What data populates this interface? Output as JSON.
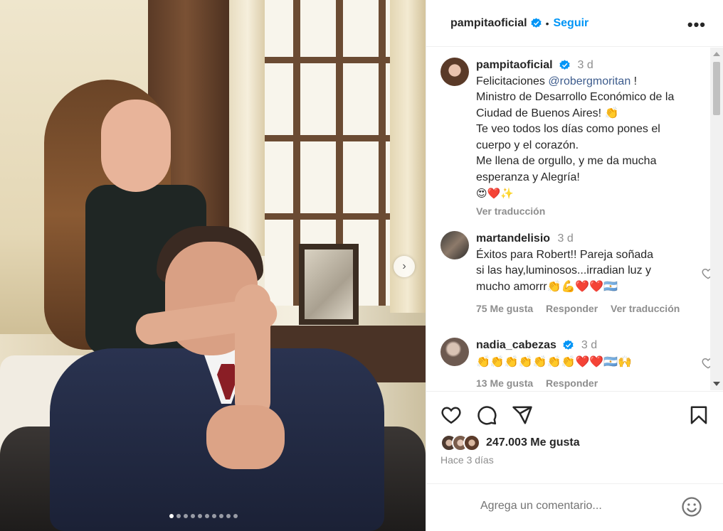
{
  "post": {
    "author": "pampitaoficial",
    "follow_label": "Seguir",
    "more_label": "•••",
    "carousel_next": "›",
    "carousel_total": 10,
    "carousel_current": 1
  },
  "caption": {
    "author": "pampitaoficial",
    "time": "3 d",
    "line1_prefix": "Felicitaciones ",
    "mention": "@robergmoritan",
    "line1_suffix": " !",
    "text_lines": [
      "Ministro de Desarrollo Económico de la",
      "Ciudad de Buenos Aires! 👏",
      "Te veo todos los días como pones el",
      "cuerpo y el corazón.",
      "Me llena de orgullo, y me da mucha",
      "esperanza y Alegría!",
      "😍❤️✨"
    ],
    "translate_label": "Ver traducción"
  },
  "comments": [
    {
      "author": "martandelisio",
      "time": "3 d",
      "text_lines": [
        "Éxitos para Robert!! Pareja soñada",
        "si las hay,luminosos...irradian luz y",
        "mucho amorrr👏💪❤️❤️🇦🇷"
      ],
      "likes": "75 Me gusta",
      "reply_label": "Responder",
      "translate_label": "Ver traducción"
    },
    {
      "author": "nadia_cabezas",
      "time": "3 d",
      "text_lines": [
        "👏👏👏👏👏👏👏❤️❤️🇦🇷🙌"
      ],
      "likes": "13 Me gusta",
      "reply_label": "Responder"
    }
  ],
  "footer": {
    "likes_count": "247.003 Me gusta",
    "time_ago": "Hace 3 días",
    "comment_placeholder": "Agrega un comentario..."
  },
  "icons": {
    "verified": "verified-badge-icon",
    "like": "heart-icon",
    "comment": "comment-icon",
    "share": "share-icon",
    "save": "bookmark-icon",
    "emoji": "smiley-icon"
  },
  "colors": {
    "accent": "#0095f6",
    "mention": "#3c5b8c",
    "muted": "#8e8e8e"
  }
}
